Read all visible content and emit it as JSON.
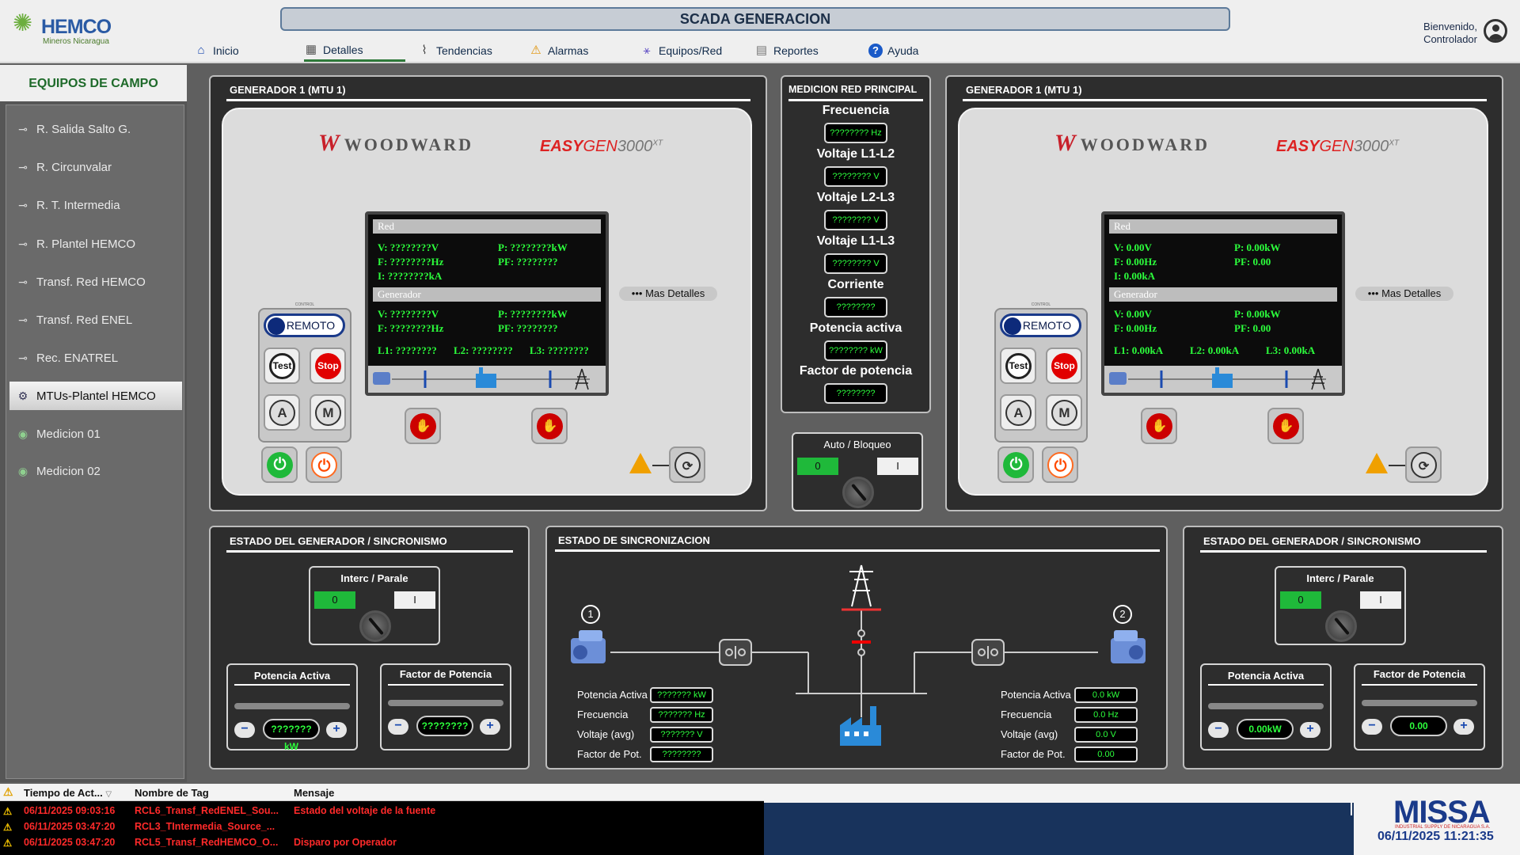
{
  "app": {
    "brand": "HEMCO",
    "brand_sub": "Mineros Nicaragua",
    "title": "SCADA GENERACION"
  },
  "nav": [
    {
      "label": "Inicio",
      "icon": "home-icon"
    },
    {
      "label": "Detalles",
      "icon": "details-icon",
      "active": true
    },
    {
      "label": "Tendencias",
      "icon": "trend-icon"
    },
    {
      "label": "Alarmas",
      "icon": "alarm-icon"
    },
    {
      "label": "Equipos/Red",
      "icon": "network-icon"
    },
    {
      "label": "Reportes",
      "icon": "report-icon"
    },
    {
      "label": "Ayuda",
      "icon": "help-icon"
    }
  ],
  "user": {
    "greeting": "Bienvenido,",
    "name": "Controlador"
  },
  "sidebar": {
    "title": "EQUIPOS DE CAMPO",
    "items": [
      {
        "label": "R. Salida Salto G.",
        "icon": "recloser-icon"
      },
      {
        "label": "R. Circunvalar",
        "icon": "recloser-icon"
      },
      {
        "label": "R. T. Intermedia",
        "icon": "recloser-icon"
      },
      {
        "label": "R. Plantel HEMCO",
        "icon": "recloser-icon"
      },
      {
        "label": "Transf. Red HEMCO",
        "icon": "recloser-icon"
      },
      {
        "label": "Transf. Red ENEL",
        "icon": "recloser-icon"
      },
      {
        "label": "Rec. ENATREL",
        "icon": "recloser-icon"
      },
      {
        "label": "MTUs-Plantel HEMCO",
        "icon": "generator-icon",
        "selected": true
      },
      {
        "label": "Medicion 01",
        "icon": "meter-icon"
      },
      {
        "label": "Medicion 02",
        "icon": "meter-icon"
      }
    ]
  },
  "gen_left": {
    "title": "GENERADOR 1 (MTU 1)",
    "brand": "WOODWARD",
    "brand_w": "W",
    "model_a": "EASY",
    "model_b": "GEN",
    "model_c": "3000",
    "model_sup": "XT",
    "red_label": "Red",
    "gen_label": "Generador",
    "red": {
      "v": "V: ????????V",
      "f": "F: ????????Hz",
      "i": "I: ????????kA",
      "p": "P: ????????kW",
      "pf": "PF: ????????"
    },
    "gen": {
      "v": "V: ????????V",
      "f": "F: ????????Hz",
      "p": "P: ????????kW",
      "pf": "PF: ????????",
      "l1": "L1: ????????",
      "l2": "L2: ????????",
      "l3": "L3: ????????"
    },
    "control_label": "CONTROL",
    "remote": "REMOTO",
    "test": "Test",
    "stop": "Stop",
    "auto": "A",
    "manual": "M",
    "more": "Mas Detalles"
  },
  "gen_right": {
    "title": "GENERADOR 1 (MTU 1)",
    "brand": "WOODWARD",
    "brand_w": "W",
    "model_a": "EASY",
    "model_b": "GEN",
    "model_c": "3000",
    "model_sup": "XT",
    "red_label": "Red",
    "gen_label": "Generador",
    "red": {
      "v": "V: 0.00V",
      "f": "F: 0.00Hz",
      "i": "I: 0.00kA",
      "p": "P: 0.00kW",
      "pf": "PF: 0.00"
    },
    "gen": {
      "v": "V: 0.00V",
      "f": "F: 0.00Hz",
      "p": "P: 0.00kW",
      "pf": "PF: 0.00",
      "l1": "L1: 0.00kA",
      "l2": "L2: 0.00kA",
      "l3": "L3: 0.00kA"
    },
    "control_label": "CONTROL",
    "remote": "REMOTO",
    "test": "Test",
    "stop": "Stop",
    "auto": "A",
    "manual": "M",
    "more": "Mas Detalles"
  },
  "medicion": {
    "title": "MEDICION RED PRINCIPAL",
    "rows": [
      {
        "label": "Frecuencia",
        "value": "???????? Hz"
      },
      {
        "label": "Voltaje L1-L2",
        "value": "???????? V"
      },
      {
        "label": "Voltaje L2-L3",
        "value": "???????? V"
      },
      {
        "label": "Voltaje L1-L3",
        "value": "???????? V"
      },
      {
        "label": "Corriente",
        "value": "????????"
      },
      {
        "label": "Potencia activa",
        "value": "???????? kW"
      },
      {
        "label": "Factor de potencia",
        "value": "????????"
      }
    ]
  },
  "auto_bloqueo": {
    "title": "Auto / Bloqueo",
    "off": "0",
    "on": "I"
  },
  "estado_left": {
    "title": "ESTADO DEL GENERADOR / SINCRONISMO",
    "interc": {
      "title": "Interc / Parale",
      "off": "0",
      "on": "I"
    },
    "potencia": {
      "title": "Potencia Activa",
      "value": "???????kW",
      "minus": "−",
      "plus": "+"
    },
    "factor": {
      "title": "Factor de Potencia",
      "value": "????????",
      "minus": "−",
      "plus": "+"
    }
  },
  "estado_right": {
    "title": "ESTADO DEL GENERADOR / SINCRONISMO",
    "interc": {
      "title": "Interc / Parale",
      "off": "0",
      "on": "I"
    },
    "potencia": {
      "title": "Potencia Activa",
      "value": "0.00kW",
      "minus": "−",
      "plus": "+"
    },
    "factor": {
      "title": "Factor de Potencia",
      "value": "0.00",
      "minus": "−",
      "plus": "+"
    }
  },
  "sync": {
    "title": "ESTADO DE SINCRONIZACION",
    "gen1_num": "1",
    "gen2_num": "2",
    "labels": [
      "Potencia Activa",
      "Frecuencia",
      "Voltaje (avg)",
      "Factor de Pot."
    ],
    "left_vals": [
      "??????? kW",
      "??????? Hz",
      "??????? V",
      "????????"
    ],
    "right_vals": [
      "0.0 kW",
      "0.0 Hz",
      "0.0 V",
      "0.00"
    ]
  },
  "alarms": {
    "headers": {
      "time": "Tiempo de Act...",
      "tag": "Nombre de Tag",
      "msg": "Mensaje"
    },
    "rows": [
      {
        "time": "06/11/2025 09:03:16",
        "tag": "RCL6_Transf_RedENEL_Sou...",
        "msg": "Estado del voltaje de la fuente"
      },
      {
        "time": "06/11/2025 03:47:20",
        "tag": "RCL3_TIntermedia_Source_...",
        "msg": ""
      },
      {
        "time": "06/11/2025 03:47:20",
        "tag": "RCL5_Transf_RedHEMCO_O...",
        "msg": "Disparo por Operador"
      }
    ]
  },
  "footer": {
    "brand": "MISSA",
    "brand_sub": "INDUSTRIAL SUPPLY DE NICARAGUA S.A.",
    "datetime": "06/11/2025  11:21:35"
  }
}
